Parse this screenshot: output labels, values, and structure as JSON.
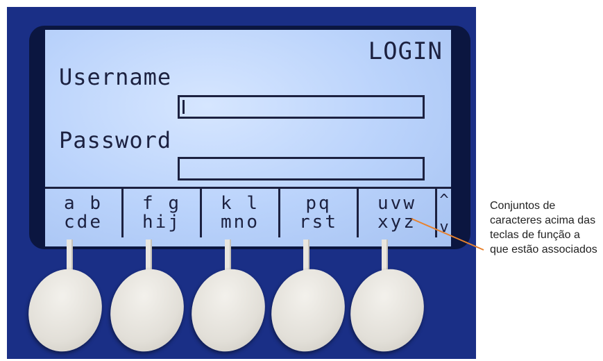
{
  "screen": {
    "title": "LOGIN",
    "username_label": "Username",
    "password_label": "Password",
    "username_value": "",
    "password_value": ""
  },
  "softkeys": [
    {
      "top": "a b",
      "bottom": "cde"
    },
    {
      "top": "f g",
      "bottom": "hij"
    },
    {
      "top": "k l",
      "bottom": "mno"
    },
    {
      "top": "pq",
      "bottom": "rst"
    },
    {
      "top": "uvw",
      "bottom": "xyz"
    }
  ],
  "scroll": {
    "up": "^",
    "down": "v"
  },
  "annotation": "Conjuntos de caracteres acima das teclas de função a que estão associados",
  "colors": {
    "panel": "#1a2f86",
    "lcd": "#b9d2fb",
    "lcd_text": "#1c2140",
    "button": "#e2dfd8",
    "leader_line": "#e8822e"
  }
}
